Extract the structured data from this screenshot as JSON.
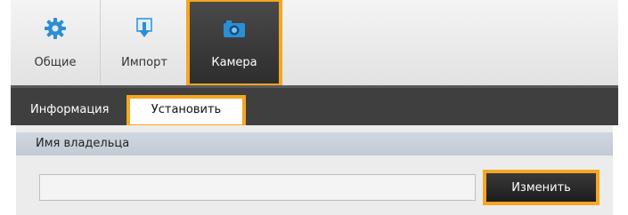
{
  "toolbar": {
    "items": [
      {
        "label": "Общие",
        "icon": "gear-icon"
      },
      {
        "label": "Импорт",
        "icon": "import-icon"
      },
      {
        "label": "Камера",
        "icon": "camera-icon"
      }
    ],
    "active_item": "Камера"
  },
  "tabs": {
    "info_label": "Информация",
    "install_label": "Установить",
    "active_tab": "Установить"
  },
  "section": {
    "header": "Имя владельца",
    "owner_value": "",
    "change_label": "Изменить"
  },
  "colors": {
    "highlight": "#f5a623",
    "icon_blue": "#2b8fd6",
    "toolbar_dark": "#3f3f3f"
  }
}
